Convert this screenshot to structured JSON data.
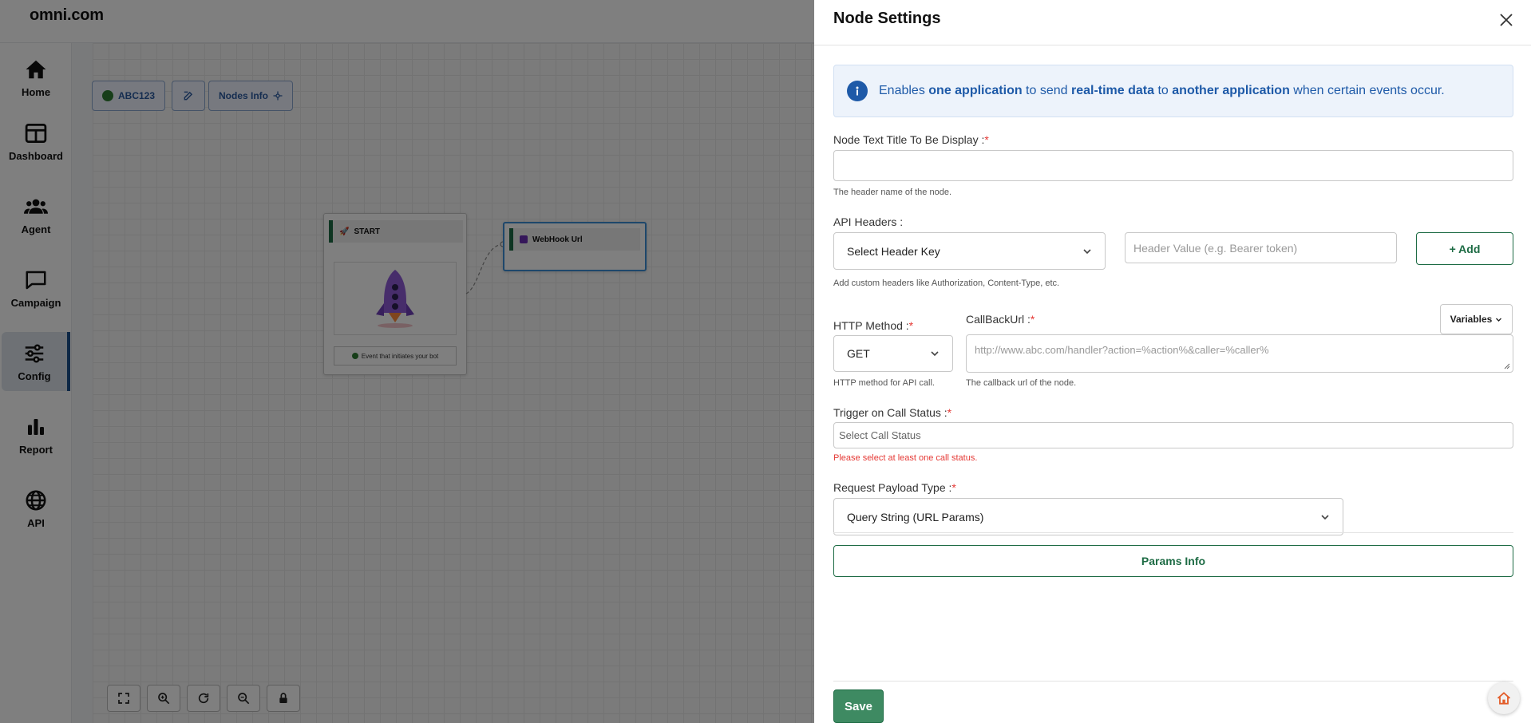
{
  "app": {
    "brand": "omni.com"
  },
  "sidebar": {
    "items": [
      {
        "label": "Home",
        "icon": "home-icon"
      },
      {
        "label": "Dashboard",
        "icon": "dashboard-icon"
      },
      {
        "label": "Agent",
        "icon": "agent-icon"
      },
      {
        "label": "Campaign",
        "icon": "campaign-icon"
      },
      {
        "label": "Config",
        "icon": "config-icon",
        "active": true
      },
      {
        "label": "Report",
        "icon": "report-icon"
      },
      {
        "label": "API",
        "icon": "api-icon"
      }
    ]
  },
  "canvas": {
    "bot_name": "ABC123",
    "nodes_info_label": "Nodes Info",
    "start_node": {
      "title": "START",
      "event_text": "Event that initiates your bot"
    },
    "webhook_node": {
      "title": "WebHook Url"
    }
  },
  "drawer": {
    "title": "Node Settings",
    "info": {
      "parts": [
        {
          "text": "Enables ",
          "bold": false
        },
        {
          "text": "one application",
          "bold": true
        },
        {
          "text": " to send ",
          "bold": false
        },
        {
          "text": "real-time data",
          "bold": true
        },
        {
          "text": " to ",
          "bold": false
        },
        {
          "text": "another application",
          "bold": true
        },
        {
          "text": " when certain events occur.",
          "bold": false
        }
      ]
    },
    "node_title": {
      "label": "Node Text Title To Be Display :",
      "required_mark": "*",
      "value": "",
      "help": "The header name of the node."
    },
    "api_headers": {
      "label": "API Headers :",
      "key_select": "Select Header Key",
      "value_placeholder": "Header Value (e.g. Bearer token)",
      "add_label": "+ Add",
      "help": "Add custom headers like Authorization, Content-Type, etc."
    },
    "http_method": {
      "label": "HTTP Method :",
      "required_mark": "*",
      "value": "GET",
      "help": "HTTP method for API call."
    },
    "callback_url": {
      "label": "CallBackUrl :",
      "required_mark": "*",
      "placeholder": "http://www.abc.com/handler?action=%action%&caller=%caller%",
      "help": "The callback url of the node.",
      "variables_label": "Variables"
    },
    "trigger": {
      "label": "Trigger on Call Status :",
      "required_mark": "*",
      "placeholder": "Select Call Status",
      "error": "Please select at least one call status."
    },
    "payload": {
      "label": "Request Payload Type :",
      "required_mark": "*",
      "value": "Query String (URL Params)"
    },
    "params_info_label": "Params Info",
    "save_label": "Save"
  },
  "colors": {
    "brand_green": "#1d6b44",
    "info_blue": "#1e5aa8",
    "error_red": "#e53935"
  }
}
